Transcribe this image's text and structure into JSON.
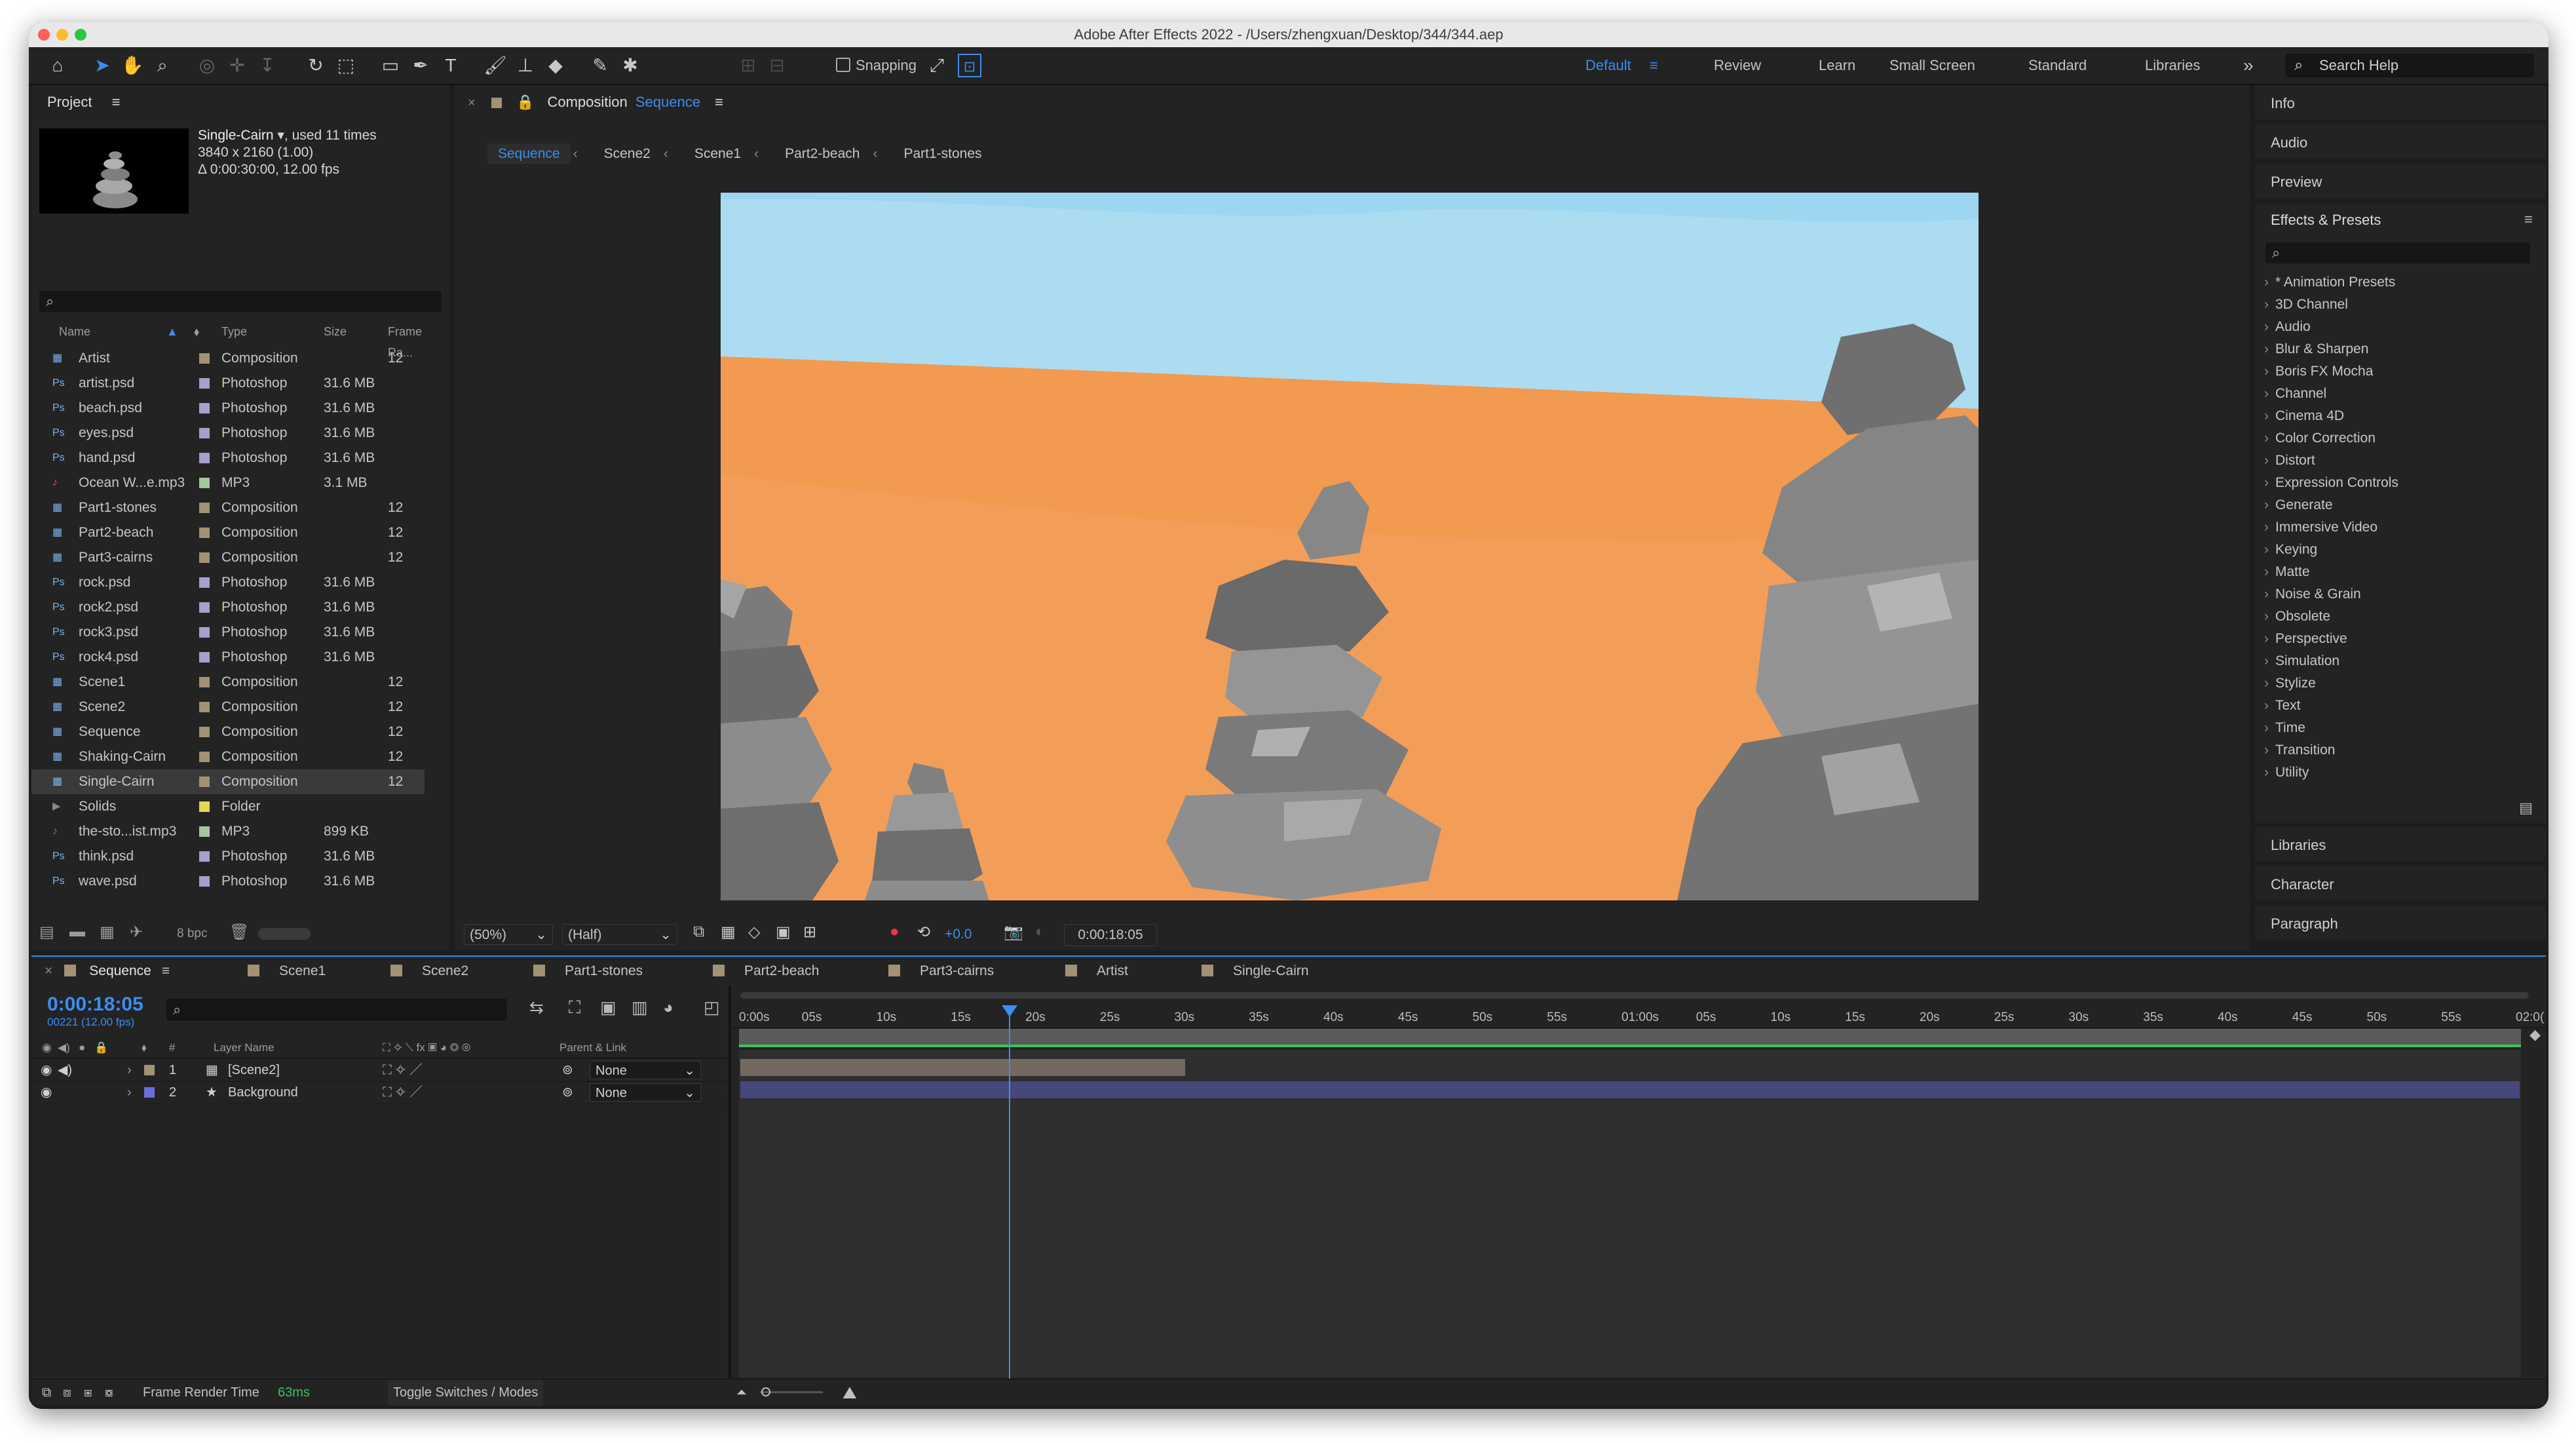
{
  "window": {
    "title": "Adobe After Effects 2022 - /Users/zhengxuan/Desktop/344/344.aep"
  },
  "workspaces": [
    "Default",
    "Review",
    "Learn",
    "Small Screen",
    "Standard",
    "Libraries"
  ],
  "toolbar": {
    "snapping_label": "Snapping",
    "search_placeholder": "Search Help"
  },
  "project": {
    "panel_title": "Project",
    "selected": {
      "name": "Single-Cairn",
      "used": ", used 11 times",
      "size": "3840 x 2160 (1.00)",
      "duration": "Δ 0:00:30:00, 12.00 fps"
    },
    "columns": {
      "name": "Name",
      "type": "Type",
      "size": "Size",
      "framerate": "Frame Ra..."
    },
    "items": [
      {
        "name": "Artist",
        "type": "Composition",
        "size": "",
        "fr": "12",
        "icon": "comp",
        "color": "#a39173"
      },
      {
        "name": "artist.psd",
        "type": "Photoshop",
        "size": "31.6 MB",
        "fr": "",
        "icon": "psd",
        "color": "#a3a2cb"
      },
      {
        "name": "beach.psd",
        "type": "Photoshop",
        "size": "31.6 MB",
        "fr": "",
        "icon": "psd",
        "color": "#a3a2cb"
      },
      {
        "name": "eyes.psd",
        "type": "Photoshop",
        "size": "31.6 MB",
        "fr": "",
        "icon": "psd",
        "color": "#a3a2cb"
      },
      {
        "name": "hand.psd",
        "type": "Photoshop",
        "size": "31.6 MB",
        "fr": "",
        "icon": "psd",
        "color": "#a3a2cb"
      },
      {
        "name": "Ocean W...e.mp3",
        "type": "MP3",
        "size": "3.1 MB",
        "fr": "",
        "icon": "mp3",
        "color": "#a1c79a"
      },
      {
        "name": "Part1-stones",
        "type": "Composition",
        "size": "",
        "fr": "12",
        "icon": "comp",
        "color": "#a39173"
      },
      {
        "name": "Part2-beach",
        "type": "Composition",
        "size": "",
        "fr": "12",
        "icon": "comp",
        "color": "#a39173"
      },
      {
        "name": "Part3-cairns",
        "type": "Composition",
        "size": "",
        "fr": "12",
        "icon": "comp",
        "color": "#a39173"
      },
      {
        "name": "rock.psd",
        "type": "Photoshop",
        "size": "31.6 MB",
        "fr": "",
        "icon": "psd",
        "color": "#a3a2cb"
      },
      {
        "name": "rock2.psd",
        "type": "Photoshop",
        "size": "31.6 MB",
        "fr": "",
        "icon": "psd",
        "color": "#a3a2cb"
      },
      {
        "name": "rock3.psd",
        "type": "Photoshop",
        "size": "31.6 MB",
        "fr": "",
        "icon": "psd",
        "color": "#a3a2cb"
      },
      {
        "name": "rock4.psd",
        "type": "Photoshop",
        "size": "31.6 MB",
        "fr": "",
        "icon": "psd",
        "color": "#a3a2cb"
      },
      {
        "name": "Scene1",
        "type": "Composition",
        "size": "",
        "fr": "12",
        "icon": "comp",
        "color": "#a39173"
      },
      {
        "name": "Scene2",
        "type": "Composition",
        "size": "",
        "fr": "12",
        "icon": "comp",
        "color": "#a39173"
      },
      {
        "name": "Sequence",
        "type": "Composition",
        "size": "",
        "fr": "12",
        "icon": "comp",
        "color": "#a39173"
      },
      {
        "name": "Shaking-Cairn",
        "type": "Composition",
        "size": "",
        "fr": "12",
        "icon": "comp",
        "color": "#a39173"
      },
      {
        "name": "Single-Cairn",
        "type": "Composition",
        "size": "",
        "fr": "12",
        "icon": "comp",
        "color": "#a39173",
        "selected": true
      },
      {
        "name": "Solids",
        "type": "Folder",
        "size": "",
        "fr": "",
        "icon": "folder",
        "color": "#e5d64e"
      },
      {
        "name": "the-sto...ist.mp3",
        "type": "MP3",
        "size": "899 KB",
        "fr": "",
        "icon": "mp3",
        "color": "#a1c79a"
      },
      {
        "name": "think.psd",
        "type": "Photoshop",
        "size": "31.6 MB",
        "fr": "",
        "icon": "psd",
        "color": "#a3a2cb"
      },
      {
        "name": "wave.psd",
        "type": "Photoshop",
        "size": "31.6 MB",
        "fr": "",
        "icon": "psd",
        "color": "#a3a2cb"
      }
    ],
    "bpc": "8 bpc"
  },
  "composition": {
    "panel_label": "Composition",
    "panel_name": "Sequence",
    "breadcrumbs": [
      "Sequence",
      "Scene2",
      "Scene1",
      "Part2-beach",
      "Part1-stones"
    ],
    "zoom": "(50%)",
    "resolution": "(Half)",
    "exposure": "+0.0",
    "timecode": "0:00:18:05"
  },
  "right_panels": {
    "top": [
      "Info",
      "Audio",
      "Preview"
    ],
    "effects_title": "Effects & Presets",
    "effects": [
      "* Animation Presets",
      "3D Channel",
      "Audio",
      "Blur & Sharpen",
      "Boris FX Mocha",
      "Channel",
      "Cinema 4D",
      "Color Correction",
      "Distort",
      "Expression Controls",
      "Generate",
      "Immersive Video",
      "Keying",
      "Matte",
      "Noise & Grain",
      "Obsolete",
      "Perspective",
      "Simulation",
      "Stylize",
      "Text",
      "Time",
      "Transition",
      "Utility"
    ],
    "bottom": [
      "Libraries",
      "Character",
      "Paragraph"
    ]
  },
  "timeline": {
    "tabs": [
      {
        "label": "Sequence",
        "active": true
      },
      {
        "label": "Scene1",
        "active": false
      },
      {
        "label": "Scene2",
        "active": false
      },
      {
        "label": "Part1-stones",
        "active": false
      },
      {
        "label": "Part2-beach",
        "active": false
      },
      {
        "label": "Part3-cairns",
        "active": false
      },
      {
        "label": "Artist",
        "active": false
      },
      {
        "label": "Single-Cairn",
        "active": false
      }
    ],
    "current_time": "0:00:18:05",
    "frame_info": "00221 (12.00 fps)",
    "columns": {
      "num": "#",
      "layer_name": "Layer Name",
      "parent": "Parent & Link"
    },
    "layers": [
      {
        "num": "1",
        "name": "[Scene2]",
        "parent": "None",
        "color": "#a39173"
      },
      {
        "num": "2",
        "name": "Background",
        "parent": "None",
        "color": "#6b6fd8"
      }
    ],
    "ruler": [
      "0:00s",
      "05s",
      "10s",
      "15s",
      "20s",
      "25s",
      "30s",
      "35s",
      "40s",
      "45s",
      "50s",
      "55s",
      "01:00s",
      "05s",
      "10s",
      "15s",
      "20s",
      "25s",
      "30s",
      "35s",
      "40s",
      "45s",
      "50s",
      "55s",
      "02:0("
    ],
    "playhead_fraction": 0.151,
    "scene2_end_fraction": 0.25,
    "frame_render_label": "Frame Render Time",
    "frame_render_value": "63ms",
    "toggle_label": "Toggle Switches / Modes"
  },
  "colors": {
    "accent": "#2d8ceb",
    "comp_label": "#a39173",
    "psd_label": "#a3a2cb",
    "mp3_label": "#a1c79a",
    "folder_label": "#e5d64e"
  }
}
